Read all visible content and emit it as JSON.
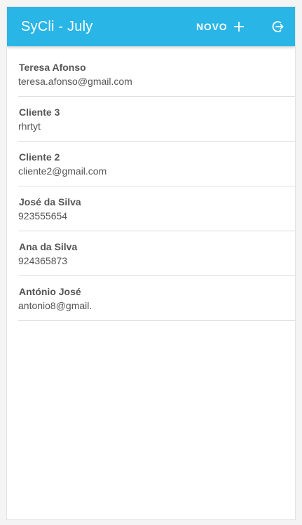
{
  "appbar": {
    "title": "SyCli - July",
    "new_label": "NOVO",
    "plus_icon": "plus-icon",
    "logout_icon": "logout-icon",
    "color": "#29b6e6"
  },
  "clients": [
    {
      "name": "Teresa Afonso",
      "detail": "teresa.afonso@gmail.com"
    },
    {
      "name": "Cliente 3",
      "detail": "rhrtyt"
    },
    {
      "name": "Cliente 2",
      "detail": "cliente2@gmail.com"
    },
    {
      "name": "José da Silva",
      "detail": "923555654"
    },
    {
      "name": "Ana da Silva",
      "detail": "924365873"
    },
    {
      "name": "António José",
      "detail": "antonio8@gmail."
    }
  ]
}
